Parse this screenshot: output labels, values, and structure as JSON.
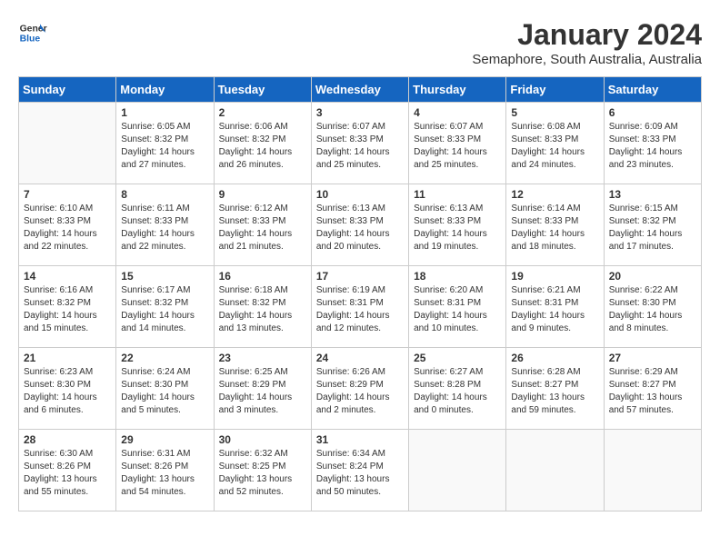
{
  "header": {
    "logo_general": "General",
    "logo_blue": "Blue",
    "month_year": "January 2024",
    "location": "Semaphore, South Australia, Australia"
  },
  "days_of_week": [
    "Sunday",
    "Monday",
    "Tuesday",
    "Wednesday",
    "Thursday",
    "Friday",
    "Saturday"
  ],
  "weeks": [
    [
      {
        "day": "",
        "content": ""
      },
      {
        "day": "1",
        "content": "Sunrise: 6:05 AM\nSunset: 8:32 PM\nDaylight: 14 hours\nand 27 minutes."
      },
      {
        "day": "2",
        "content": "Sunrise: 6:06 AM\nSunset: 8:32 PM\nDaylight: 14 hours\nand 26 minutes."
      },
      {
        "day": "3",
        "content": "Sunrise: 6:07 AM\nSunset: 8:33 PM\nDaylight: 14 hours\nand 25 minutes."
      },
      {
        "day": "4",
        "content": "Sunrise: 6:07 AM\nSunset: 8:33 PM\nDaylight: 14 hours\nand 25 minutes."
      },
      {
        "day": "5",
        "content": "Sunrise: 6:08 AM\nSunset: 8:33 PM\nDaylight: 14 hours\nand 24 minutes."
      },
      {
        "day": "6",
        "content": "Sunrise: 6:09 AM\nSunset: 8:33 PM\nDaylight: 14 hours\nand 23 minutes."
      }
    ],
    [
      {
        "day": "7",
        "content": "Sunrise: 6:10 AM\nSunset: 8:33 PM\nDaylight: 14 hours\nand 22 minutes."
      },
      {
        "day": "8",
        "content": "Sunrise: 6:11 AM\nSunset: 8:33 PM\nDaylight: 14 hours\nand 22 minutes."
      },
      {
        "day": "9",
        "content": "Sunrise: 6:12 AM\nSunset: 8:33 PM\nDaylight: 14 hours\nand 21 minutes."
      },
      {
        "day": "10",
        "content": "Sunrise: 6:13 AM\nSunset: 8:33 PM\nDaylight: 14 hours\nand 20 minutes."
      },
      {
        "day": "11",
        "content": "Sunrise: 6:13 AM\nSunset: 8:33 PM\nDaylight: 14 hours\nand 19 minutes."
      },
      {
        "day": "12",
        "content": "Sunrise: 6:14 AM\nSunset: 8:33 PM\nDaylight: 14 hours\nand 18 minutes."
      },
      {
        "day": "13",
        "content": "Sunrise: 6:15 AM\nSunset: 8:32 PM\nDaylight: 14 hours\nand 17 minutes."
      }
    ],
    [
      {
        "day": "14",
        "content": "Sunrise: 6:16 AM\nSunset: 8:32 PM\nDaylight: 14 hours\nand 15 minutes."
      },
      {
        "day": "15",
        "content": "Sunrise: 6:17 AM\nSunset: 8:32 PM\nDaylight: 14 hours\nand 14 minutes."
      },
      {
        "day": "16",
        "content": "Sunrise: 6:18 AM\nSunset: 8:32 PM\nDaylight: 14 hours\nand 13 minutes."
      },
      {
        "day": "17",
        "content": "Sunrise: 6:19 AM\nSunset: 8:31 PM\nDaylight: 14 hours\nand 12 minutes."
      },
      {
        "day": "18",
        "content": "Sunrise: 6:20 AM\nSunset: 8:31 PM\nDaylight: 14 hours\nand 10 minutes."
      },
      {
        "day": "19",
        "content": "Sunrise: 6:21 AM\nSunset: 8:31 PM\nDaylight: 14 hours\nand 9 minutes."
      },
      {
        "day": "20",
        "content": "Sunrise: 6:22 AM\nSunset: 8:30 PM\nDaylight: 14 hours\nand 8 minutes."
      }
    ],
    [
      {
        "day": "21",
        "content": "Sunrise: 6:23 AM\nSunset: 8:30 PM\nDaylight: 14 hours\nand 6 minutes."
      },
      {
        "day": "22",
        "content": "Sunrise: 6:24 AM\nSunset: 8:30 PM\nDaylight: 14 hours\nand 5 minutes."
      },
      {
        "day": "23",
        "content": "Sunrise: 6:25 AM\nSunset: 8:29 PM\nDaylight: 14 hours\nand 3 minutes."
      },
      {
        "day": "24",
        "content": "Sunrise: 6:26 AM\nSunset: 8:29 PM\nDaylight: 14 hours\nand 2 minutes."
      },
      {
        "day": "25",
        "content": "Sunrise: 6:27 AM\nSunset: 8:28 PM\nDaylight: 14 hours\nand 0 minutes."
      },
      {
        "day": "26",
        "content": "Sunrise: 6:28 AM\nSunset: 8:27 PM\nDaylight: 13 hours\nand 59 minutes."
      },
      {
        "day": "27",
        "content": "Sunrise: 6:29 AM\nSunset: 8:27 PM\nDaylight: 13 hours\nand 57 minutes."
      }
    ],
    [
      {
        "day": "28",
        "content": "Sunrise: 6:30 AM\nSunset: 8:26 PM\nDaylight: 13 hours\nand 55 minutes."
      },
      {
        "day": "29",
        "content": "Sunrise: 6:31 AM\nSunset: 8:26 PM\nDaylight: 13 hours\nand 54 minutes."
      },
      {
        "day": "30",
        "content": "Sunrise: 6:32 AM\nSunset: 8:25 PM\nDaylight: 13 hours\nand 52 minutes."
      },
      {
        "day": "31",
        "content": "Sunrise: 6:34 AM\nSunset: 8:24 PM\nDaylight: 13 hours\nand 50 minutes."
      },
      {
        "day": "",
        "content": ""
      },
      {
        "day": "",
        "content": ""
      },
      {
        "day": "",
        "content": ""
      }
    ]
  ]
}
